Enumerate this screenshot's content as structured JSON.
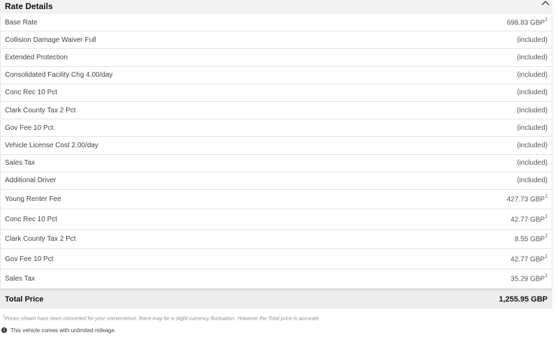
{
  "header": {
    "title": "Rate Details"
  },
  "rate_rows": [
    {
      "label": "Base Rate",
      "amount": "698.83 GBP",
      "footnote_mark": "1"
    },
    {
      "label": "Collision Damage Waiver Full",
      "amount": "(included)",
      "footnote_mark": ""
    },
    {
      "label": "Extended Protection",
      "amount": "(included)",
      "footnote_mark": ""
    },
    {
      "label": "Consolidated Facility Chg 4.00/day",
      "amount": "(included)",
      "footnote_mark": ""
    },
    {
      "label": "Conc Rec 10 Pct",
      "amount": "(included)",
      "footnote_mark": ""
    },
    {
      "label": "Clark County Tax 2 Pct",
      "amount": "(included)",
      "footnote_mark": ""
    },
    {
      "label": "Gov Fee 10 Pct",
      "amount": "(included)",
      "footnote_mark": ""
    },
    {
      "label": "Vehicle License Cost 2.00/day",
      "amount": "(included)",
      "footnote_mark": ""
    },
    {
      "label": "Sales Tax",
      "amount": "(included)",
      "footnote_mark": ""
    },
    {
      "label": "Additional Driver",
      "amount": "(included)",
      "footnote_mark": ""
    }
  ],
  "fee_rows": [
    {
      "label": "Young Renter Fee",
      "amount": "427.73 GBP",
      "footnote_mark": "1"
    },
    {
      "label": "Conc Rec 10 Pct",
      "amount": "42.77 GBP",
      "footnote_mark": "1"
    },
    {
      "label": "Clark County Tax 2 Pct",
      "amount": "8.55 GBP",
      "footnote_mark": "1"
    },
    {
      "label": "Gov Fee 10 Pct",
      "amount": "42.77 GBP",
      "footnote_mark": "1"
    },
    {
      "label": "Sales Tax",
      "amount": "35.29 GBP",
      "footnote_mark": "1"
    }
  ],
  "total": {
    "label": "Total Price",
    "amount": "1,255.95 GBP"
  },
  "footnote": {
    "mark": "1",
    "text": "Prices shown have been converted for your convenience, there may be a slight currency fluctuation. However the Total price is accurate"
  },
  "mileage_note": "This vehicle comes with unlimited mileage.",
  "icons": {
    "collapse": "chevron-up-icon",
    "info": "info-icon"
  }
}
